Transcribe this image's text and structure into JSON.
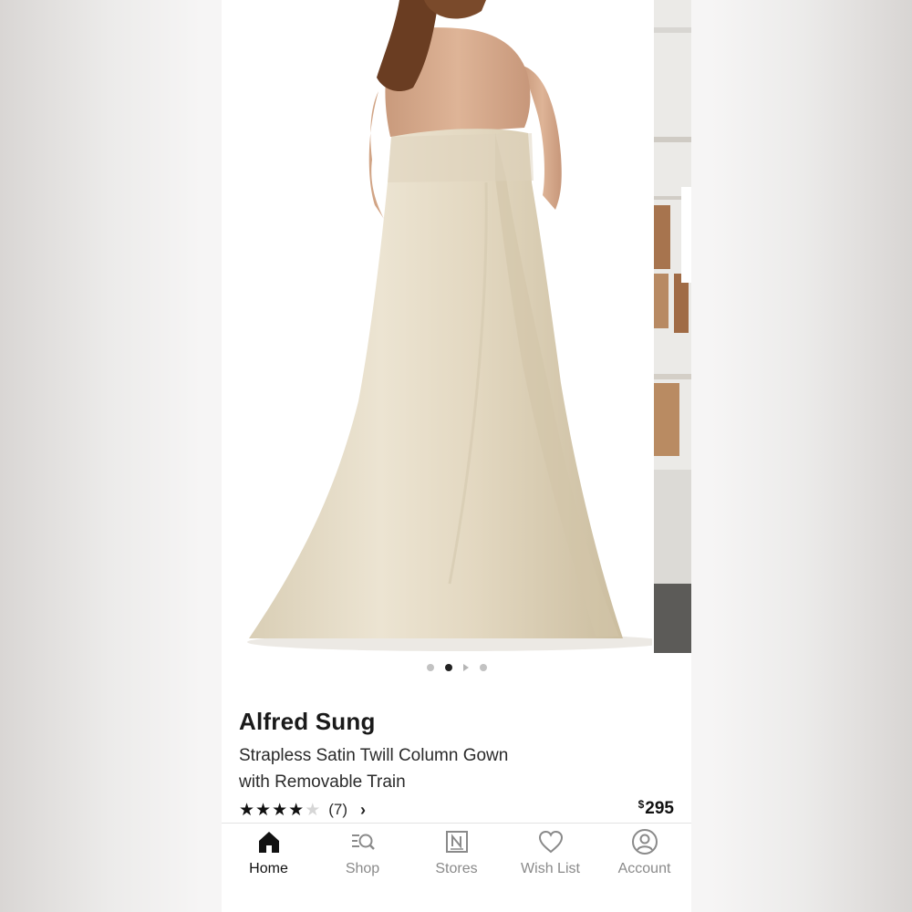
{
  "product": {
    "brand": "Alfred Sung",
    "name": "Strapless Satin Twill Column Gown with Removable Train",
    "rating": {
      "stars_filled": 4,
      "stars_total": 5,
      "review_count": "(7)"
    },
    "price": {
      "currency": "$",
      "amount": "295"
    }
  },
  "gallery": {
    "image_count": 4,
    "active_index": 1,
    "video_index": 2
  },
  "tabbar": {
    "items": [
      {
        "label": "Home",
        "icon": "home-icon",
        "active": true
      },
      {
        "label": "Shop",
        "icon": "shop-search-icon",
        "active": false
      },
      {
        "label": "Stores",
        "icon": "store-icon",
        "active": false
      },
      {
        "label": "Wish List",
        "icon": "heart-icon",
        "active": false
      },
      {
        "label": "Account",
        "icon": "account-icon",
        "active": false
      }
    ]
  },
  "colors": {
    "gown": "#e6dcc6",
    "text_primary": "#1a1a1a",
    "tab_inactive": "#8a8a8a"
  }
}
